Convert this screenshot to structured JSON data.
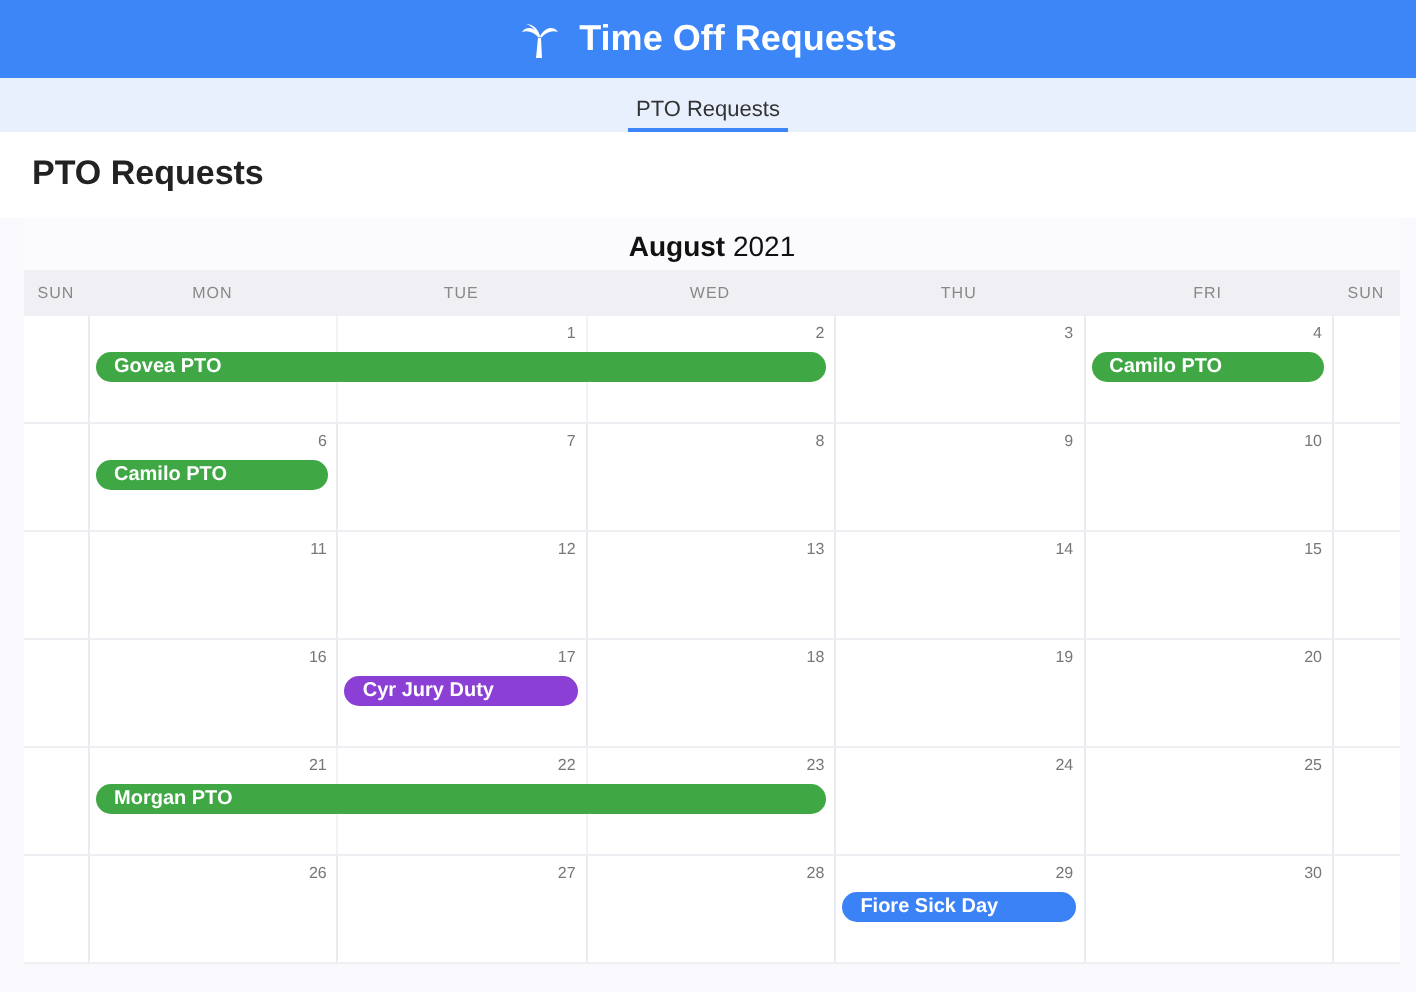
{
  "app_bar": {
    "title": "Time Off Requests"
  },
  "tabs": [
    {
      "label": "PTO Requests",
      "selected": true
    }
  ],
  "page_title": "PTO Requests",
  "calendar": {
    "month": "August",
    "year": "2021",
    "weekdays": [
      "SUN",
      "MON",
      "TUE",
      "WED",
      "THU",
      "FRI",
      "SUN"
    ],
    "weeks": [
      [
        {
          "kind": "edge"
        },
        {
          "kind": "day",
          "event": {
            "label": "Govea PTO",
            "color": "#3fa845"
          }
        },
        {
          "kind": "day",
          "number": "1",
          "covered": true
        },
        {
          "kind": "day",
          "number": "2",
          "covered": true
        },
        {
          "kind": "day",
          "number": "3"
        },
        {
          "kind": "day",
          "number": "4",
          "event": {
            "label": "Camilo PTO",
            "color": "#3fa845"
          }
        },
        {
          "kind": "edge"
        }
      ],
      [
        {
          "kind": "edge"
        },
        {
          "kind": "day",
          "number": "6",
          "event": {
            "label": "Camilo PTO",
            "color": "#3fa845"
          }
        },
        {
          "kind": "day",
          "number": "7"
        },
        {
          "kind": "day",
          "number": "8"
        },
        {
          "kind": "day",
          "number": "9"
        },
        {
          "kind": "day",
          "number": "10"
        },
        {
          "kind": "edge"
        }
      ],
      [
        {
          "kind": "edge"
        },
        {
          "kind": "day",
          "number": "11"
        },
        {
          "kind": "day",
          "number": "12"
        },
        {
          "kind": "day",
          "number": "13"
        },
        {
          "kind": "day",
          "number": "14"
        },
        {
          "kind": "day",
          "number": "15"
        },
        {
          "kind": "edge"
        }
      ],
      [
        {
          "kind": "edge"
        },
        {
          "kind": "day",
          "number": "16"
        },
        {
          "kind": "day",
          "number": "17",
          "event": {
            "label": "Cyr Jury Duty",
            "color": "#8b3fd4"
          }
        },
        {
          "kind": "day",
          "number": "18"
        },
        {
          "kind": "day",
          "number": "19"
        },
        {
          "kind": "day",
          "number": "20"
        },
        {
          "kind": "edge"
        }
      ],
      [
        {
          "kind": "edge"
        },
        {
          "kind": "day",
          "number": "21",
          "event": {
            "label": "Morgan PTO",
            "color": "#3fa845"
          }
        },
        {
          "kind": "day",
          "number": "22",
          "covered": true
        },
        {
          "kind": "day",
          "number": "23",
          "covered": true
        },
        {
          "kind": "day",
          "number": "24"
        },
        {
          "kind": "day",
          "number": "25"
        },
        {
          "kind": "edge"
        }
      ],
      [
        {
          "kind": "edge"
        },
        {
          "kind": "day",
          "number": "26"
        },
        {
          "kind": "day",
          "number": "27"
        },
        {
          "kind": "day",
          "number": "28"
        },
        {
          "kind": "day",
          "number": "29",
          "event": {
            "label": "Fiore Sick Day",
            "color": "#3b82f6"
          }
        },
        {
          "kind": "day",
          "number": "30"
        },
        {
          "kind": "edge"
        }
      ]
    ]
  }
}
